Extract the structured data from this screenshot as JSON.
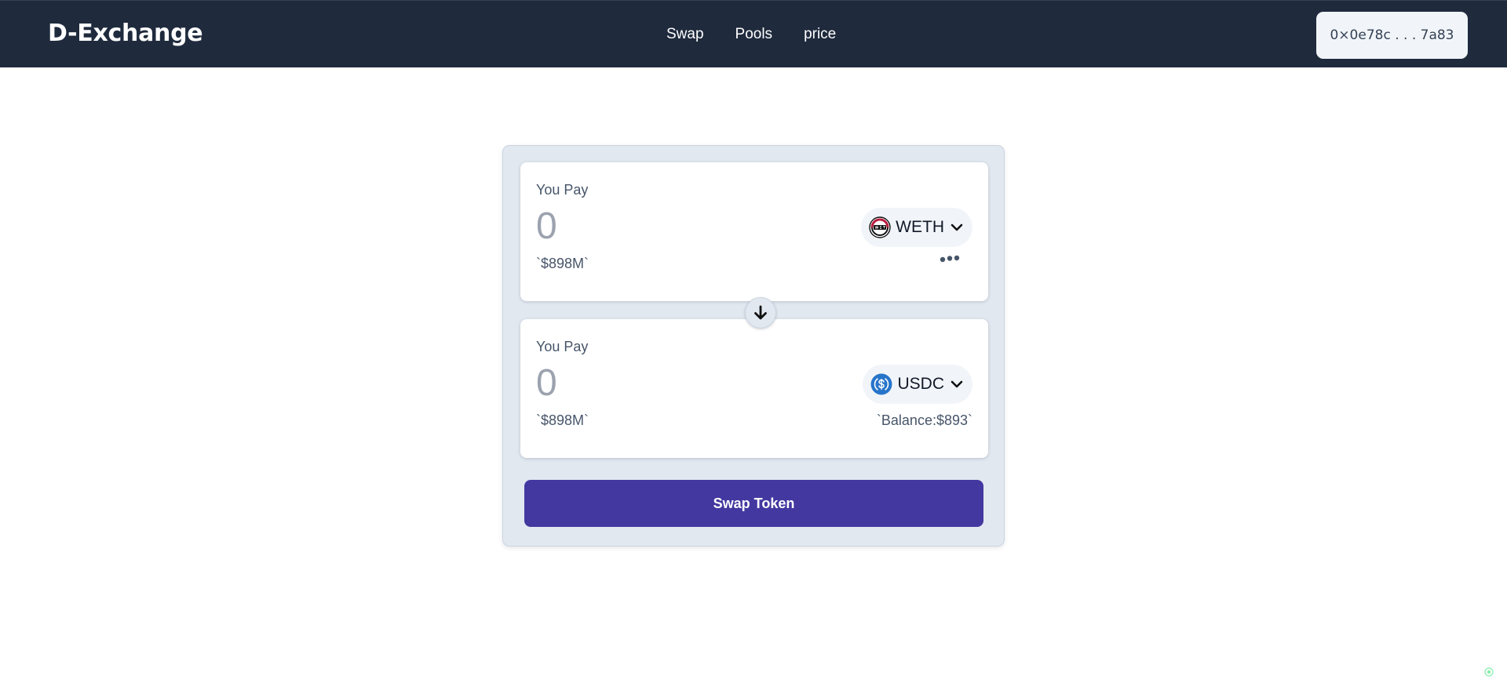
{
  "header": {
    "brand": "D-Exchange",
    "nav": [
      {
        "label": "Swap"
      },
      {
        "label": "Pools"
      },
      {
        "label": "price"
      }
    ],
    "wallet": "0×0e78c . . . 7a83"
  },
  "swap": {
    "from": {
      "label": "You Pay",
      "amount_placeholder": "0",
      "usd_value": "`$898M`",
      "token": {
        "symbol": "WETH",
        "icon": "weth-logo-icon"
      },
      "more_icon": "ellipsis-icon"
    },
    "flip_icon": "arrow-down-icon",
    "to": {
      "label": "You Pay",
      "amount_placeholder": "0",
      "usd_value": "`$898M`",
      "token": {
        "symbol": "USDC",
        "icon": "usdc-logo-icon"
      },
      "balance": "`Balance:$893`"
    },
    "submit_label": "Swap Token"
  },
  "colors": {
    "header_bg": "#1f2a3d",
    "card_bg": "#e2e8f0",
    "button_bg": "#4338a0",
    "usdc_blue": "#2775ca"
  }
}
